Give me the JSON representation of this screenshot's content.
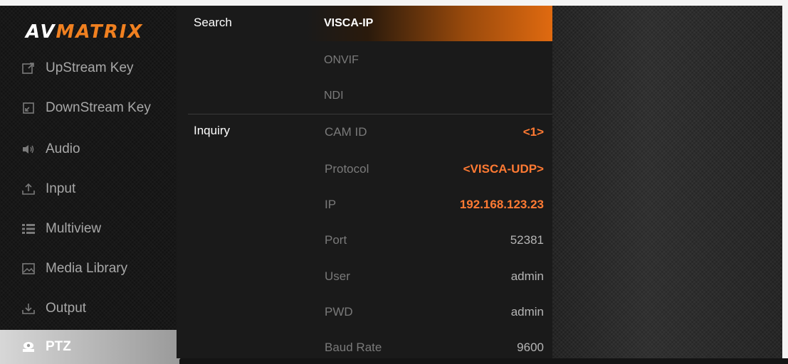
{
  "logo": {
    "part1": "AV",
    "part2": "MATRIX"
  },
  "sidebar": {
    "items": [
      {
        "label": "UpStream Key",
        "icon": "upstream-key-icon"
      },
      {
        "label": "DownStream Key",
        "icon": "downstream-key-icon"
      },
      {
        "label": "Audio",
        "icon": "speaker-icon"
      },
      {
        "label": "Input",
        "icon": "input-icon"
      },
      {
        "label": "Multiview",
        "icon": "multiview-icon"
      },
      {
        "label": "Media Library",
        "icon": "image-icon"
      },
      {
        "label": "Output",
        "icon": "output-icon"
      },
      {
        "label": "PTZ",
        "icon": "camera-icon",
        "active": true
      }
    ]
  },
  "search": {
    "label": "Search",
    "options": [
      "VISCA-IP",
      "ONVIF",
      "NDI"
    ],
    "selected": "VISCA-IP"
  },
  "inquiry": {
    "label": "Inquiry",
    "rows": [
      {
        "label": "CAM ID",
        "value": "<1>"
      },
      {
        "label": "Protocol",
        "value": "<VISCA-UDP>"
      },
      {
        "label": "IP",
        "value": "192.168.123.23"
      },
      {
        "label": "Port",
        "value": "52381"
      },
      {
        "label": "User",
        "value": "admin"
      },
      {
        "label": "PWD",
        "value": "admin"
      },
      {
        "label": "Baud Rate",
        "value": "9600"
      }
    ]
  },
  "colors": {
    "accent": "#ff7a33",
    "brand_orange": "#f08020",
    "active_bar": "#e06a10"
  }
}
